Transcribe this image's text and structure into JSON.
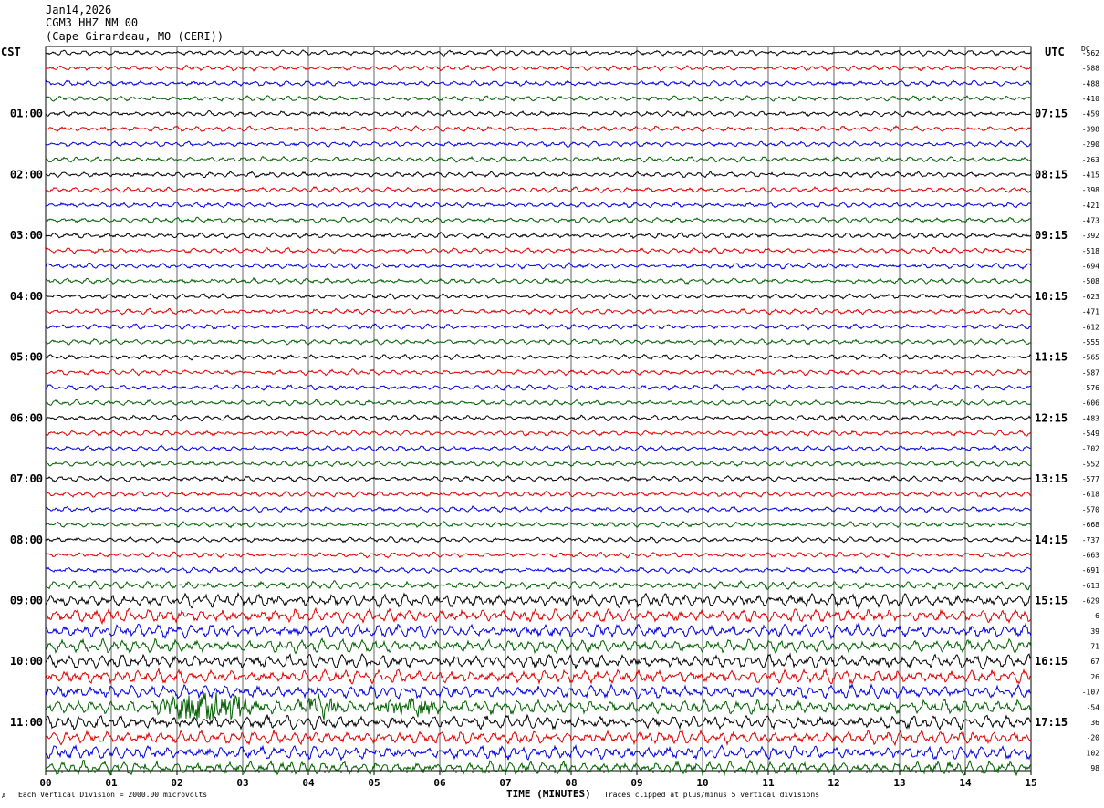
{
  "header": {
    "date": "Jan14,2026",
    "station": "CGM3 HHZ NM 00",
    "location": "(Cape Girardeau, MO (CERI))"
  },
  "left_timezone": "CST",
  "right_timezone": "UTC",
  "dc_header": "DC",
  "footer": {
    "scale_note": "Each Vertical Division = 2000.00 microvolts",
    "xlabel": "TIME (MINUTES)",
    "clip_note": "Traces clipped at plus/minus 5 vertical divisions",
    "corner_mark": "A"
  },
  "chart_data": {
    "type": "line",
    "subtype": "helicorder",
    "xlabel": "TIME (MINUTES)",
    "xlim": [
      0,
      15
    ],
    "x_tick_labels": [
      "00",
      "01",
      "02",
      "03",
      "04",
      "05",
      "06",
      "07",
      "08",
      "09",
      "10",
      "11",
      "12",
      "13",
      "14",
      "15"
    ],
    "grid": "vertical lines at each minute",
    "left_time_labels": [
      "01:00",
      "02:00",
      "03:00",
      "04:00",
      "05:00",
      "06:00",
      "07:00",
      "08:00",
      "09:00",
      "10:00",
      "11:00"
    ],
    "right_time_labels": [
      "07:15",
      "08:15",
      "09:15",
      "10:15",
      "11:15",
      "12:15",
      "13:15",
      "14:15",
      "15:15",
      "16:15",
      "17:15"
    ],
    "trace_colors": [
      "#000000",
      "#e00000",
      "#0000e0",
      "#006000"
    ],
    "dc_offsets": [
      "-562",
      "-588",
      "-488",
      "-410",
      "-459",
      "-398",
      "-290",
      "-263",
      "-415",
      "-398",
      "-421",
      "-473",
      "-392",
      "-518",
      "-694",
      "-508",
      "-623",
      "-471",
      "-612",
      "-555",
      "-565",
      "-587",
      "-576",
      "-606",
      "-483",
      "-549",
      "-702",
      "-552",
      "-577",
      "-618",
      "-570",
      "-668",
      "-737",
      "-663",
      "-691",
      "-613",
      "-629",
      "6",
      "39",
      "-71",
      "67",
      "26",
      "-107",
      "-54",
      "36",
      "-20",
      "102",
      "98"
    ],
    "noise_amplitude": [
      2,
      2,
      2,
      2,
      2,
      2,
      2,
      2,
      2,
      2,
      2,
      2,
      2,
      2,
      2,
      2,
      2,
      2,
      2,
      2,
      2,
      2,
      2,
      2,
      2,
      2,
      2,
      2,
      2,
      2,
      2,
      2,
      2,
      2,
      2,
      3,
      5,
      5,
      5,
      5,
      5,
      5,
      5,
      5,
      5,
      5,
      5,
      5
    ],
    "events": [
      {
        "trace": 43,
        "start_minute": 1.5,
        "end_minute": 3.4,
        "amplitude": 14
      },
      {
        "trace": 43,
        "start_minute": 3.8,
        "end_minute": 4.5,
        "amplitude": 10
      },
      {
        "trace": 43,
        "start_minute": 4.9,
        "end_minute": 6.1,
        "amplitude": 9
      }
    ]
  }
}
